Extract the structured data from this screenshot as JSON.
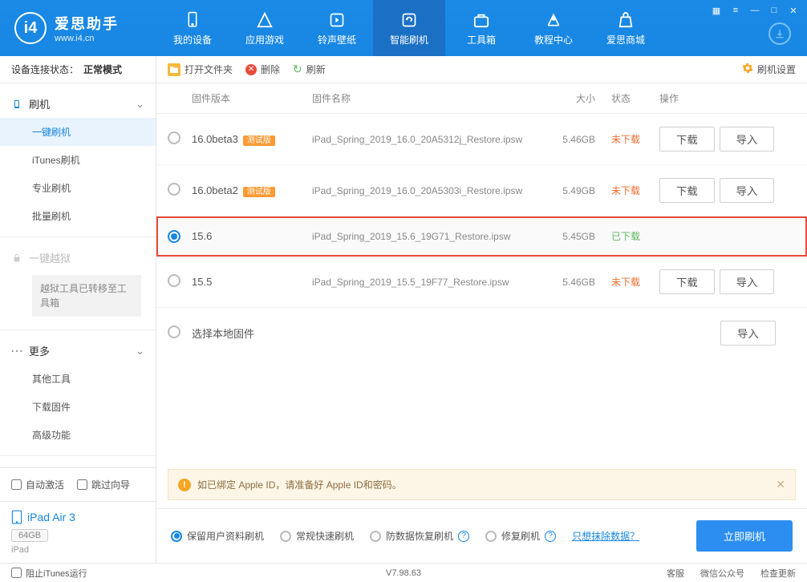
{
  "app": {
    "title": "爱思助手",
    "subtitle": "www.i4.cn",
    "nav": [
      {
        "label": "我的设备"
      },
      {
        "label": "应用游戏"
      },
      {
        "label": "铃声壁纸"
      },
      {
        "label": "智能刷机"
      },
      {
        "label": "工具箱"
      },
      {
        "label": "教程中心"
      },
      {
        "label": "爱思商城"
      }
    ]
  },
  "status": {
    "label": "设备连接状态：",
    "value": "正常模式"
  },
  "sidebar": {
    "groups": [
      {
        "title": "刷机",
        "items": [
          "一键刷机",
          "iTunes刷机",
          "专业刷机",
          "批量刷机"
        ]
      },
      {
        "title": "一键越狱",
        "note": "越狱工具已转移至工具箱"
      },
      {
        "title": "更多",
        "items": [
          "其他工具",
          "下载固件",
          "高级功能"
        ]
      }
    ],
    "auto_activate": "自动激活",
    "skip_guide": "跳过向导",
    "device": {
      "name": "iPad Air 3",
      "storage": "64GB",
      "type": "iPad"
    }
  },
  "toolbar": {
    "open_folder": "打开文件夹",
    "delete": "删除",
    "refresh": "刷新",
    "settings": "刷机设置"
  },
  "table": {
    "headers": {
      "version": "固件版本",
      "name": "固件名称",
      "size": "大小",
      "status": "状态",
      "ops": "操作"
    },
    "rows": [
      {
        "version": "16.0beta3",
        "beta": "测试版",
        "name": "iPad_Spring_2019_16.0_20A5312j_Restore.ipsw",
        "size": "5.46GB",
        "status": "未下载",
        "st_class": "st-not",
        "selected": false,
        "show_ops": true
      },
      {
        "version": "16.0beta2",
        "beta": "测试版",
        "name": "iPad_Spring_2019_16.0_20A5303i_Restore.ipsw",
        "size": "5.49GB",
        "status": "未下载",
        "st_class": "st-not",
        "selected": false,
        "show_ops": true
      },
      {
        "version": "15.6",
        "beta": "",
        "name": "iPad_Spring_2019_15.6_19G71_Restore.ipsw",
        "size": "5.45GB",
        "status": "已下载",
        "st_class": "st-done",
        "selected": true,
        "show_ops": false,
        "highlighted": true
      },
      {
        "version": "15.5",
        "beta": "",
        "name": "iPad_Spring_2019_15.5_19F77_Restore.ipsw",
        "size": "5.46GB",
        "status": "未下载",
        "st_class": "st-not",
        "selected": false,
        "show_ops": true
      }
    ],
    "local_label": "选择本地固件",
    "btn_download": "下载",
    "btn_import": "导入"
  },
  "warning": "如已绑定 Apple ID，请准备好 Apple ID和密码。",
  "options": {
    "keep": "保留用户资料刷机",
    "normal": "常规快速刷机",
    "anti": "防数据恢复刷机",
    "repair": "修复刷机",
    "erase_link": "只想抹除数据？",
    "flash_btn": "立即刷机"
  },
  "footer": {
    "block_itunes": "阻止iTunes运行",
    "version": "V7.98.63",
    "right": [
      "客服",
      "微信公众号",
      "检查更新"
    ]
  }
}
